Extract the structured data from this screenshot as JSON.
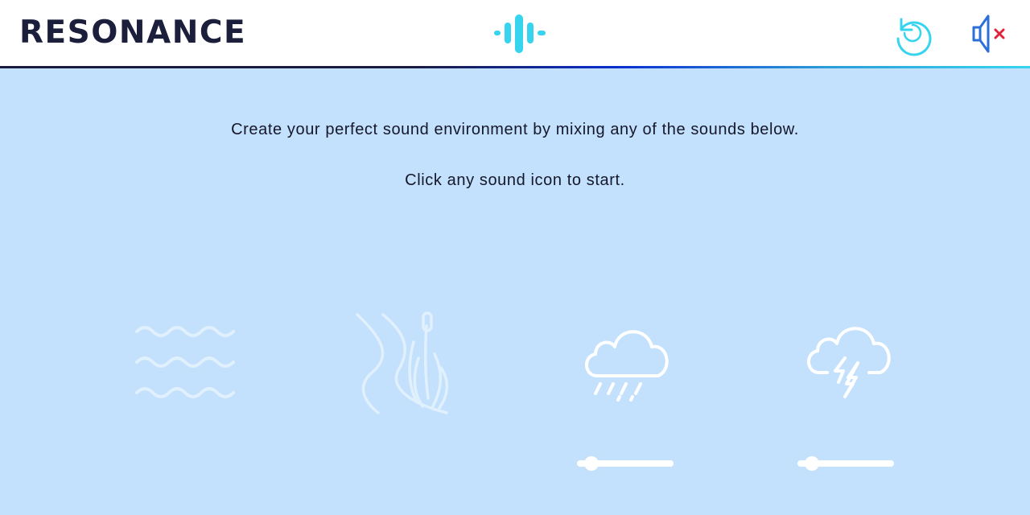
{
  "header": {
    "title": "RESONANCE",
    "logo_icon": "waveform-icon",
    "restart_icon": "restart-icon",
    "mute_icon": "speaker-muted-icon"
  },
  "main": {
    "intro": "Create your perfect sound environment by mixing any of the sounds below.",
    "hint": "Click any sound icon to start."
  },
  "sounds": [
    {
      "icon": "waves-icon",
      "active": false
    },
    {
      "icon": "stream-reeds-icon",
      "active": false
    },
    {
      "icon": "rain-cloud-icon",
      "active": true,
      "volume": 0.1
    },
    {
      "icon": "thunderstorm-icon",
      "active": true,
      "volume": 0.1
    }
  ],
  "colors": {
    "background": "#c3e1fc",
    "header": "#ffffff",
    "title": "#1b1f3b",
    "accent_cyan": "#37d4f0",
    "accent_blue": "#2b6fd8",
    "mute_x": "#e0233a"
  }
}
